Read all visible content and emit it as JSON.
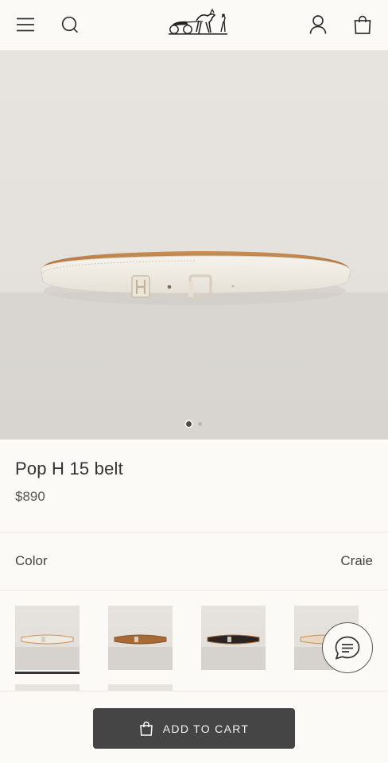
{
  "header": {
    "menu_icon": "hamburger-menu-icon",
    "search_icon": "search-icon",
    "logo_icon": "carriage-logo",
    "account_icon": "user-icon",
    "bag_icon": "shopping-bag-icon"
  },
  "gallery": {
    "slides_total": 2,
    "active_slide": 1
  },
  "product": {
    "title": "Pop H 15 belt",
    "price": "$890"
  },
  "color": {
    "label": "Color",
    "selected": "Craie",
    "swatches": [
      {
        "name": "craie",
        "selected": true
      },
      {
        "name": "gold",
        "selected": false
      },
      {
        "name": "black",
        "selected": false
      },
      {
        "name": "natural",
        "selected": false
      }
    ]
  },
  "chat": {
    "icon": "chat-bubble-icon"
  },
  "cart": {
    "button_label": "ADD TO CART",
    "icon": "shopping-bag-icon"
  },
  "colors": {
    "background": "#fcfaf6",
    "button": "#454545",
    "text": "#444444"
  }
}
